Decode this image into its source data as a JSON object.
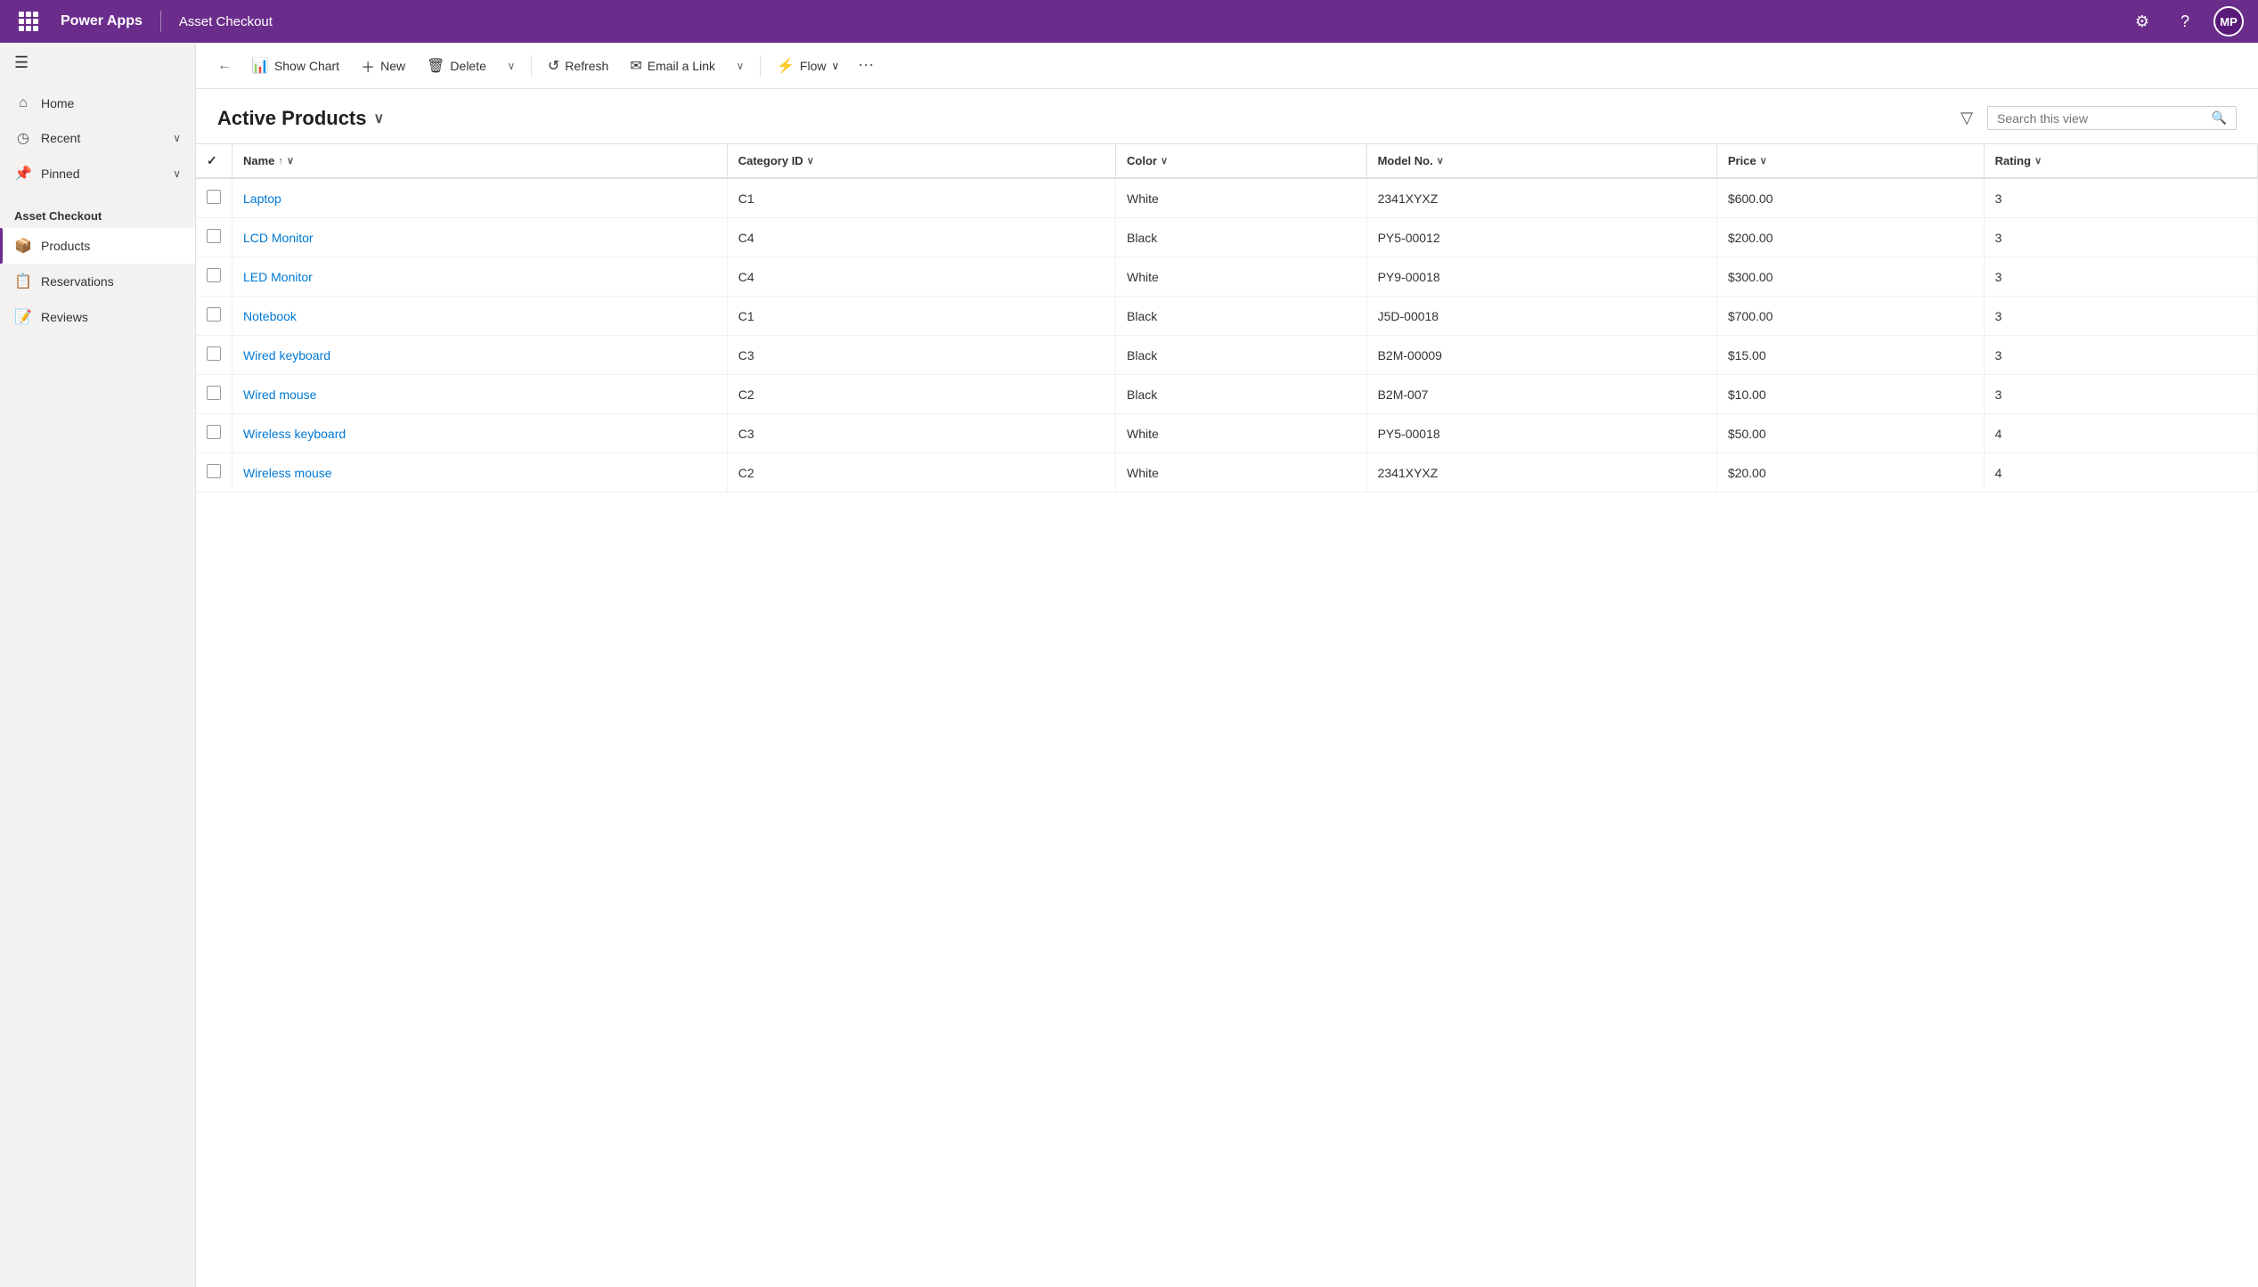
{
  "topbar": {
    "app_name": "Power Apps",
    "page_title": "Asset Checkout",
    "settings_label": "Settings",
    "help_label": "Help",
    "user_initials": "MP"
  },
  "sidebar": {
    "nav_items": [
      {
        "id": "home",
        "label": "Home",
        "icon": "⌂",
        "has_chevron": false
      },
      {
        "id": "recent",
        "label": "Recent",
        "icon": "◷",
        "has_chevron": true
      },
      {
        "id": "pinned",
        "label": "Pinned",
        "icon": "📌",
        "has_chevron": true
      }
    ],
    "section_title": "Asset Checkout",
    "app_items": [
      {
        "id": "products",
        "label": "Products",
        "icon": "📦",
        "active": true
      },
      {
        "id": "reservations",
        "label": "Reservations",
        "icon": "📋",
        "active": false
      },
      {
        "id": "reviews",
        "label": "Reviews",
        "icon": "📝",
        "active": false
      }
    ]
  },
  "command_bar": {
    "show_chart_label": "Show Chart",
    "new_label": "New",
    "delete_label": "Delete",
    "refresh_label": "Refresh",
    "email_link_label": "Email a Link",
    "flow_label": "Flow"
  },
  "view": {
    "title": "Active Products",
    "search_placeholder": "Search this view"
  },
  "table": {
    "columns": [
      {
        "id": "name",
        "label": "Name",
        "sortable": true,
        "sort_dir": "asc"
      },
      {
        "id": "category_id",
        "label": "Category ID",
        "sortable": true
      },
      {
        "id": "color",
        "label": "Color",
        "sortable": true
      },
      {
        "id": "model_no",
        "label": "Model No.",
        "sortable": true
      },
      {
        "id": "price",
        "label": "Price",
        "sortable": true
      },
      {
        "id": "rating",
        "label": "Rating",
        "sortable": true
      }
    ],
    "rows": [
      {
        "name": "Laptop",
        "category_id": "C1",
        "color": "White",
        "model_no": "2341XYXZ",
        "price": "$600.00",
        "rating": "3"
      },
      {
        "name": "LCD Monitor",
        "category_id": "C4",
        "color": "Black",
        "model_no": "PY5-00012",
        "price": "$200.00",
        "rating": "3"
      },
      {
        "name": "LED Monitor",
        "category_id": "C4",
        "color": "White",
        "model_no": "PY9-00018",
        "price": "$300.00",
        "rating": "3"
      },
      {
        "name": "Notebook",
        "category_id": "C1",
        "color": "Black",
        "model_no": "J5D-00018",
        "price": "$700.00",
        "rating": "3"
      },
      {
        "name": "Wired keyboard",
        "category_id": "C3",
        "color": "Black",
        "model_no": "B2M-00009",
        "price": "$15.00",
        "rating": "3"
      },
      {
        "name": "Wired mouse",
        "category_id": "C2",
        "color": "Black",
        "model_no": "B2M-007",
        "price": "$10.00",
        "rating": "3"
      },
      {
        "name": "Wireless keyboard",
        "category_id": "C3",
        "color": "White",
        "model_no": "PY5-00018",
        "price": "$50.00",
        "rating": "4"
      },
      {
        "name": "Wireless mouse",
        "category_id": "C2",
        "color": "White",
        "model_no": "2341XYXZ",
        "price": "$20.00",
        "rating": "4"
      }
    ]
  }
}
